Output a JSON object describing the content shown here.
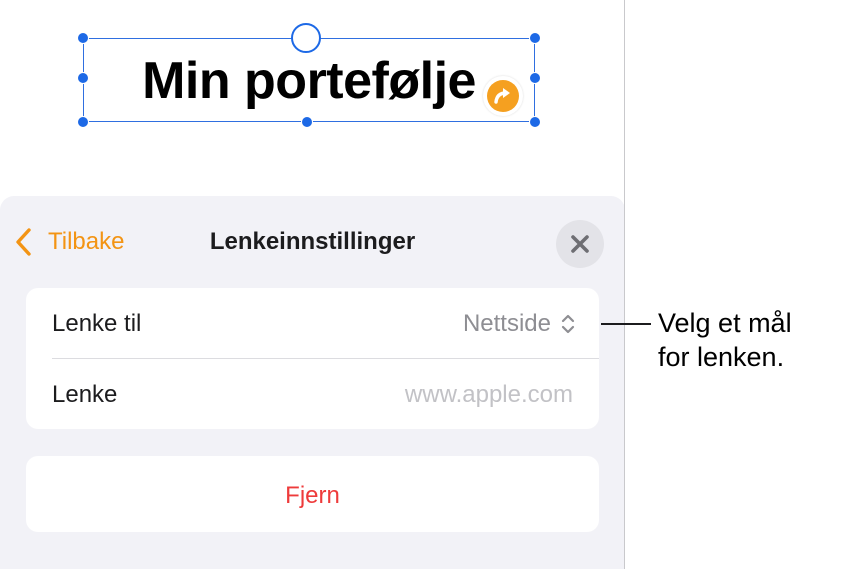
{
  "canvas": {
    "title": "Min portefølje",
    "link_icon": "arrow-link-icon"
  },
  "sheet": {
    "back_label": "Tilbake",
    "title": "Lenkeinnstillinger",
    "close_icon": "close-icon",
    "rows": [
      {
        "label": "Lenke til",
        "value": "Nettside",
        "icon": "chevron-up-down-icon"
      },
      {
        "label": "Lenke",
        "placeholder": "www.apple.com"
      }
    ],
    "remove_label": "Fjern"
  },
  "callout": {
    "line1": "Velg et mål",
    "line2": "for lenken."
  },
  "colors": {
    "accent": "#f39414",
    "selection": "#1d69e6",
    "destructive": "#ee3b3b",
    "sheet_bg": "#f2f2f7"
  }
}
